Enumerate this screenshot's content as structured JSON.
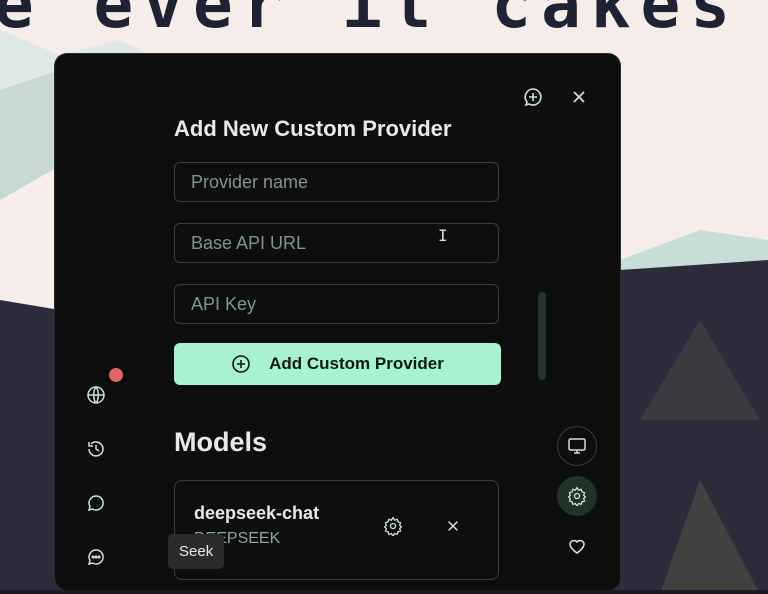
{
  "background": {
    "title_text": "e ever it cakes"
  },
  "panel": {
    "top_icons": {
      "new_chat_icon": "chat-plus-icon",
      "close_icon": "close-icon"
    },
    "custom_provider": {
      "heading": "Add New Custom Provider",
      "provider_name_placeholder": "Provider name",
      "base_url_placeholder": "Base API URL",
      "api_key_placeholder": "API Key",
      "add_button_label": "Add Custom Provider"
    },
    "models": {
      "heading": "Models",
      "items": [
        {
          "name": "deepseek-chat",
          "provider": "DEEPSEEK"
        }
      ]
    },
    "left_rail": [
      "globe-icon",
      "history-icon",
      "chat-bubble-icon",
      "chat-dots-icon"
    ],
    "right_rail": [
      "monitor-icon",
      "gear-icon",
      "heart-icon"
    ],
    "tooltip": "Seek"
  },
  "colors": {
    "panel_bg": "#0d0f0f",
    "accent": "#a7f3d0",
    "notification": "#e26565"
  }
}
